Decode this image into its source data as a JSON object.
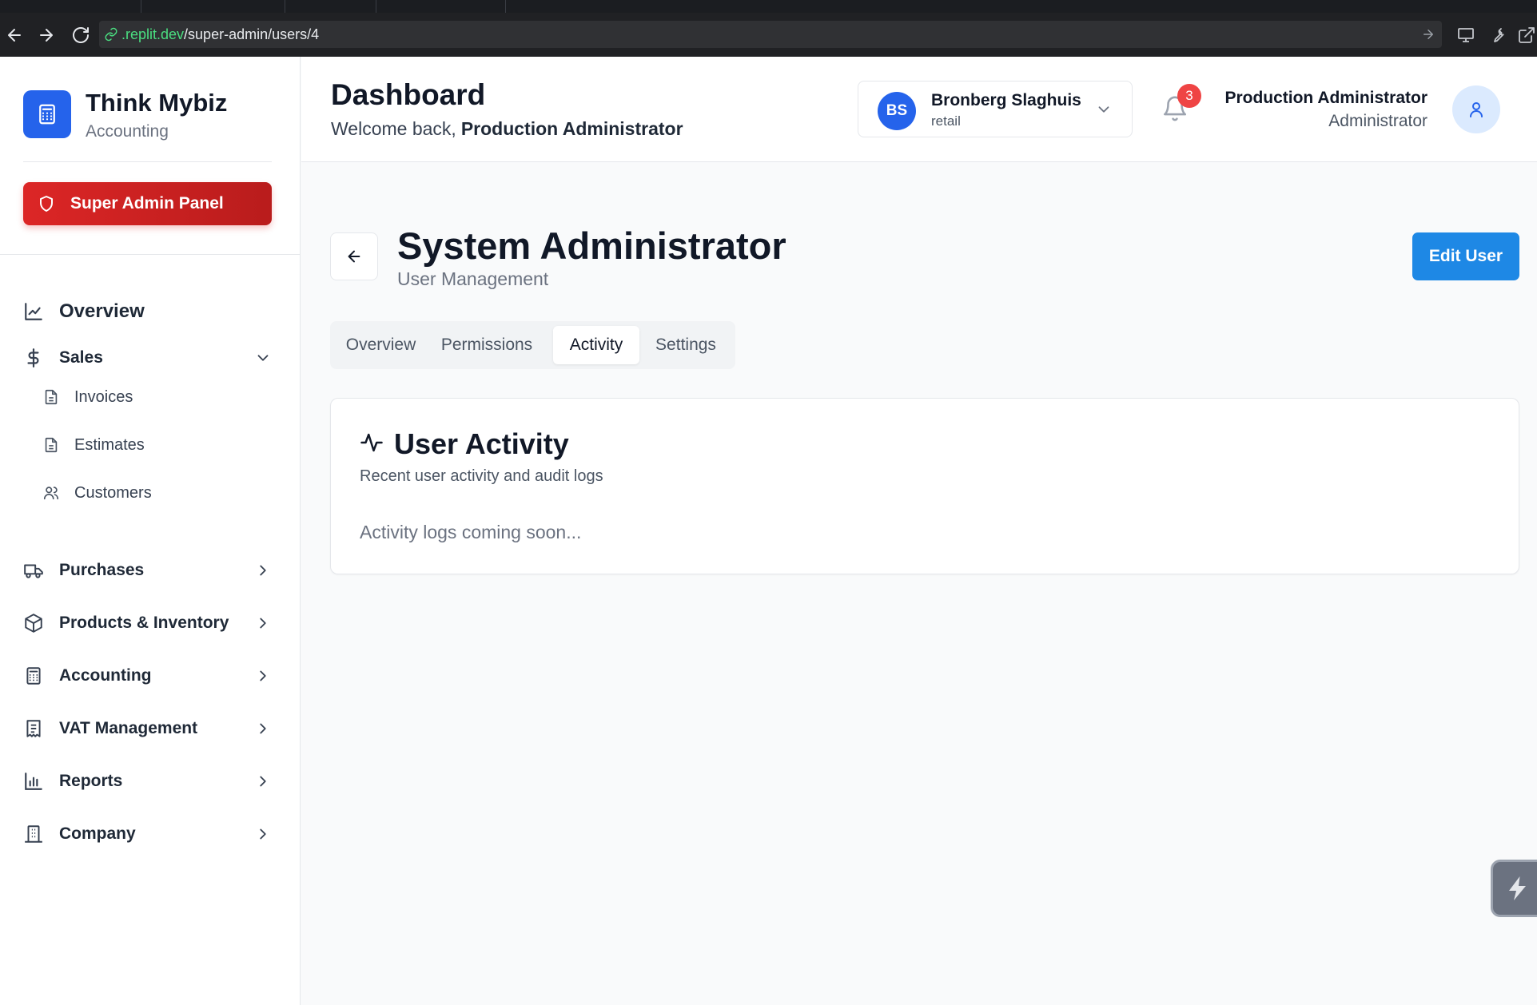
{
  "browser": {
    "url_host": ".replit.dev",
    "url_path": "/super-admin/users/4"
  },
  "sidebar": {
    "brand_name": "Think Mybiz",
    "brand_sub": "Accounting",
    "super_admin_label": "Super Admin Panel",
    "items": [
      {
        "label": "Overview",
        "icon": "line-chart-icon"
      },
      {
        "label": "Sales",
        "icon": "dollar-icon",
        "expanded": true
      },
      {
        "label": "Invoices",
        "icon": "file-text-icon"
      },
      {
        "label": "Estimates",
        "icon": "file-text-icon"
      },
      {
        "label": "Customers",
        "icon": "users-icon"
      },
      {
        "label": "Purchases",
        "icon": "truck-icon"
      },
      {
        "label": "Products & Inventory",
        "icon": "package-icon"
      },
      {
        "label": "Accounting",
        "icon": "calculator-icon"
      },
      {
        "label": "VAT Management",
        "icon": "receipt-icon"
      },
      {
        "label": "Reports",
        "icon": "bar-chart-icon"
      },
      {
        "label": "Company",
        "icon": "building-icon"
      }
    ]
  },
  "header": {
    "title": "Dashboard",
    "welcome_prefix": "Welcome back,",
    "welcome_name": "Production Administrator",
    "company": {
      "initials": "BS",
      "name": "Bronberg Slaghuis",
      "type": "retail"
    },
    "notifications_count": "3",
    "user": {
      "name": "Production Administrator",
      "role": "Administrator"
    }
  },
  "main": {
    "title": "System Administrator",
    "subtitle": "User Management",
    "edit_button": "Edit User",
    "tabs": [
      {
        "label": "Overview",
        "active": false
      },
      {
        "label": "Permissions",
        "active": false
      },
      {
        "label": "Activity",
        "active": true
      },
      {
        "label": "Settings",
        "active": false
      }
    ],
    "card": {
      "title": "User Activity",
      "subtitle": "Recent user activity and audit logs",
      "empty_message": "Activity logs coming soon..."
    }
  },
  "colors": {
    "brand_blue": "#2563eb",
    "super_admin_red": "#dc2626",
    "edit_button_blue": "#1e88e5",
    "badge_red": "#ef4444"
  }
}
